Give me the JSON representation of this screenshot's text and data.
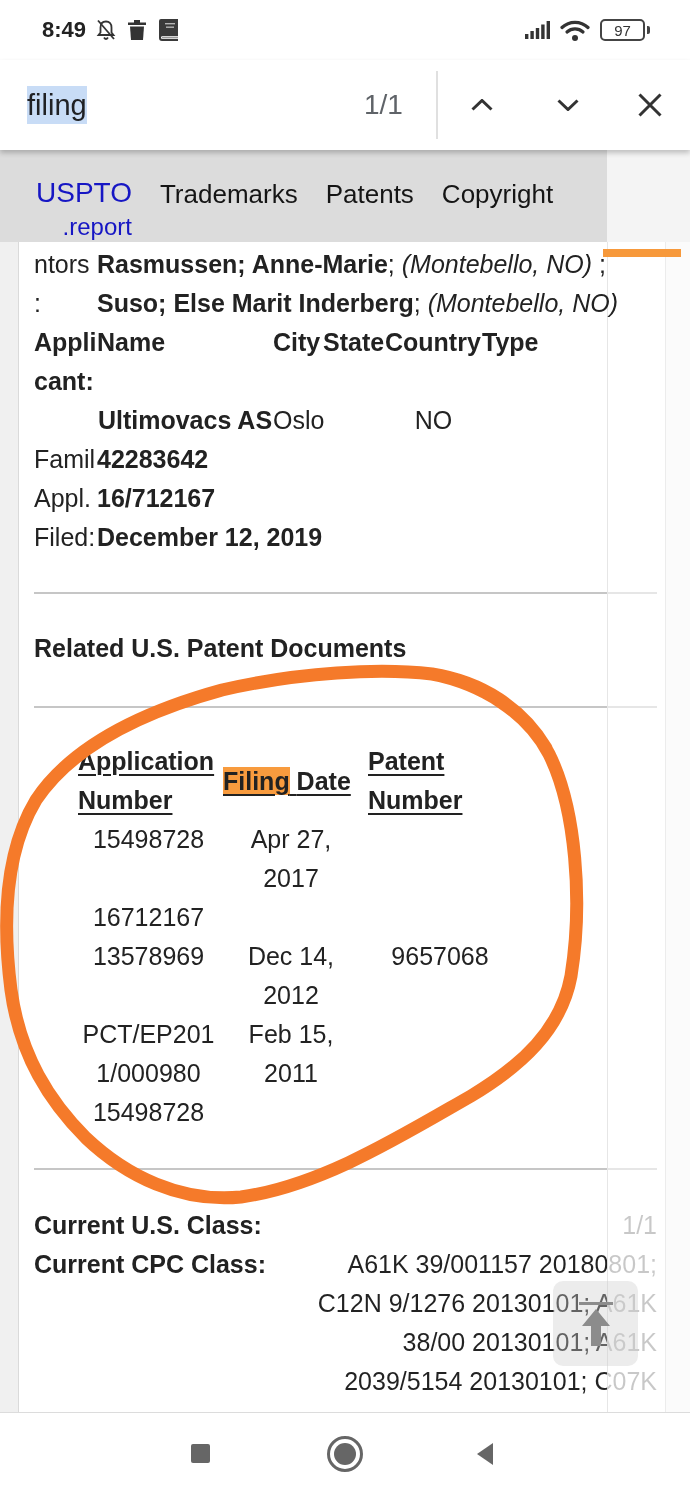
{
  "status_bar": {
    "time": "8:49",
    "battery": "97"
  },
  "find_bar": {
    "query": "filing",
    "query_selected": true,
    "match_count": "1/1"
  },
  "site_nav": {
    "logo": "USPTO",
    "logo_suffix": ".report",
    "links": [
      "Trademarks",
      "Patents",
      "Copyright"
    ]
  },
  "details": {
    "inventors": {
      "label_lines": [
        "ntors",
        ":"
      ],
      "entries": [
        "**Rasmussen; Anne-Marie**; *(Montebello, NO)* ;",
        "**Suso; Else Marit Inderberg**; *(Montebello, NO)*"
      ]
    },
    "applicant": {
      "label_lines": [
        "Appli",
        "cant:"
      ],
      "columns": [
        "Name",
        "City",
        "State",
        "Country",
        "Type"
      ],
      "rows": [
        {
          "name": "Ultimovacs AS",
          "city": "Oslo",
          "country": "NO"
        }
      ]
    },
    "fields": [
      {
        "label": "Famil",
        "value": "42283642"
      },
      {
        "label": "Appl.",
        "value": "16/712167"
      },
      {
        "label": "Filed:",
        "value": "December 12, 2019"
      }
    ]
  },
  "related_documents": {
    "heading": "Related U.S. Patent Documents",
    "columns": [
      {
        "parts": [
          {
            "text": "Application Number",
            "highlighted": false
          }
        ]
      },
      {
        "parts": [
          {
            "text": "Filing",
            "highlighted": true
          },
          {
            "text": "Date",
            "highlighted": false
          }
        ]
      },
      {
        "parts": [
          {
            "text": "Patent Number",
            "highlighted": false
          }
        ]
      }
    ],
    "rows": [
      {
        "application_number": "15498728",
        "filing_date": "Apr 27, 2017"
      },
      {
        "application_number": "16712167"
      },
      {
        "application_number": "13578969",
        "filing_date": "Dec 14, 2012",
        "patent_number": "9657068"
      },
      {
        "application_number": "PCT/EP2011/000980",
        "filing_date": "Feb 15, 2011"
      },
      {
        "application_number": "15498728"
      }
    ]
  },
  "classes": [
    {
      "label": "Current U.S. Class:",
      "value": "1/1"
    },
    {
      "label": "Current CPC Class:",
      "value": "A61K 39/001157 20180801; C12N 9/1276 20130101; A61K 38/00 20130101; A61K 2039/5154 20130101; C07K"
    }
  ]
}
